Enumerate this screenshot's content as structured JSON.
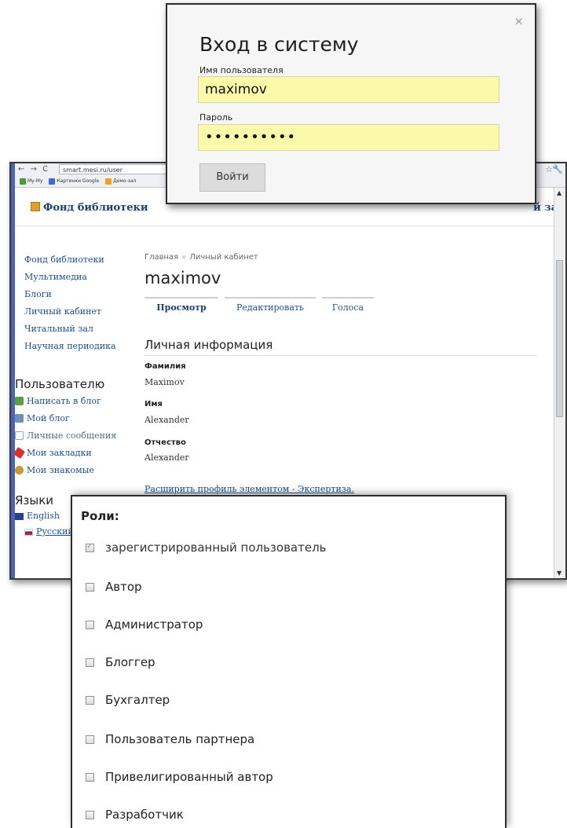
{
  "browser": {
    "nav_glyphs": "← → C",
    "url": "smart.mesi.ru/user",
    "bookmarks": [
      "My-My",
      "Картинки Google",
      "Демо-зал"
    ],
    "star_icon": "star-icon",
    "wrench_icon": "wrench-icon"
  },
  "site": {
    "logo_text": "Фонд библиотеки",
    "header_right": "й за"
  },
  "sidebar": {
    "nav_items": [
      {
        "label": "Фонд библиотеки"
      },
      {
        "label": "Мультимедиа"
      },
      {
        "label": "Блоги"
      },
      {
        "label": "Личный кабинет"
      },
      {
        "label": "Читальный зал"
      },
      {
        "label": "Научная периодика"
      }
    ],
    "user_section_title": "Пользователю",
    "user_tools": [
      {
        "label": "Написать в блог",
        "icon": "write-blog-icon"
      },
      {
        "label": "Мой блог",
        "icon": "blog-icon"
      },
      {
        "label": "Личные сообщения",
        "icon": "envelope-icon"
      },
      {
        "label": "Мои закладки",
        "icon": "bookmark-icon"
      },
      {
        "label": "Мои знакомые",
        "icon": "contacts-icon"
      }
    ],
    "languages_title": "Языки",
    "languages": [
      {
        "label": "English"
      },
      {
        "label": "Русский"
      }
    ]
  },
  "main": {
    "breadcrumb": [
      "Главная",
      "Личный кабинет"
    ],
    "breadcrumb_sep": "»",
    "user_title": "maximov",
    "tabs": [
      {
        "label": "Просмотр",
        "active": true
      },
      {
        "label": "Редактировать",
        "active": false
      },
      {
        "label": "Голоса",
        "active": false
      }
    ],
    "info_title": "Личная информация",
    "fields": [
      {
        "label": "Фамилия",
        "value": "Maximov"
      },
      {
        "label": "Имя",
        "value": "Alexander"
      },
      {
        "label": "Отчество",
        "value": "Alexander"
      }
    ],
    "expand_link": "Расширить профиль элементом - Экспертиза."
  },
  "login": {
    "title": "Вход в систему",
    "username_label": "Имя пользователя",
    "username_value": "maximov",
    "password_label": "Пароль",
    "password_value": "••••••••••",
    "submit_label": "Войти",
    "close_glyph": "×"
  },
  "roles": {
    "title": "Роли:",
    "items": [
      {
        "label": "зарегистрированный пользователь",
        "checked": true
      },
      {
        "label": "Автор",
        "checked": false
      },
      {
        "label": "Администратор",
        "checked": false
      },
      {
        "label": "Блоггер",
        "checked": false
      },
      {
        "label": "Бухгалтер",
        "checked": false
      },
      {
        "label": "Пользователь партнера",
        "checked": false
      },
      {
        "label": "Привелигированный автор",
        "checked": false
      },
      {
        "label": "Разработчик",
        "checked": false
      }
    ]
  }
}
